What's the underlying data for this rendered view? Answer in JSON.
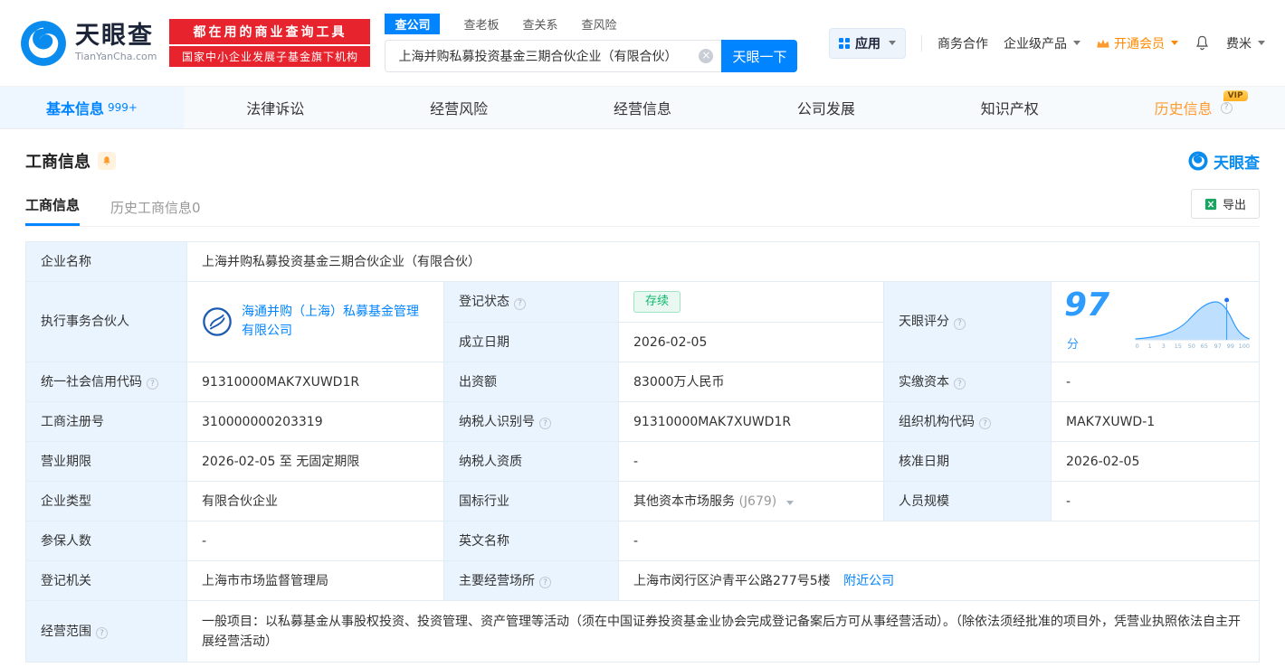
{
  "colors": {
    "blue": "#0084ff",
    "red": "#e7232d",
    "orange": "#ff9a2e",
    "green": "#0fb96c",
    "label_bg": "#e9f4fe"
  },
  "brand": {
    "name": "天眼查",
    "domain": "TianYanCha.com"
  },
  "banner": {
    "line1": "都在用的商业查询工具",
    "line2": "国家中小企业发展子基金旗下机构"
  },
  "search": {
    "tabs": [
      {
        "label": "查公司"
      },
      {
        "label": "查老板"
      },
      {
        "label": "查关系"
      },
      {
        "label": "查风险"
      }
    ],
    "value": "上海并购私募投资基金三期合伙企业（有限合伙）",
    "button": "天眼一下"
  },
  "header_right": {
    "apps": "应用",
    "cooperation": "商务合作",
    "enterprise": "企业级产品",
    "vip": "开通会员",
    "user": "费米"
  },
  "nav": {
    "tabs": [
      {
        "label": "基本信息",
        "badge": "999+"
      },
      {
        "label": "法律诉讼"
      },
      {
        "label": "经营风险"
      },
      {
        "label": "经营信息"
      },
      {
        "label": "公司发展"
      },
      {
        "label": "知识产权"
      },
      {
        "label": "历史信息",
        "vip": "VIP"
      }
    ]
  },
  "section": {
    "title": "工商信息",
    "logo_text": "天眼查",
    "tab_current": "工商信息",
    "tab_history": "历史工商信息0",
    "export": "导出"
  },
  "info": {
    "company_name_label": "企业名称",
    "company_name": "上海并购私募投资基金三期合伙企业（有限合伙）",
    "partner_label": "执行事务合伙人",
    "partner_name": "海通并购（上海）私募基金管理有限公司",
    "status_label": "登记状态",
    "status": "存续",
    "establish_label": "成立日期",
    "establish_date": "2026-02-05",
    "score_label": "天眼评分",
    "score": "97",
    "score_unit": "分",
    "credit_code_label": "统一社会信用代码",
    "credit_code": "91310000MAK7XUWD1R",
    "capital_label": "出资额",
    "capital": "83000万人民币",
    "paid_capital_label": "实缴资本",
    "paid_capital": "-",
    "reg_no_label": "工商注册号",
    "reg_no": "310000000203319",
    "taxpayer_id_label": "纳税人识别号",
    "taxpayer_id": "91310000MAK7XUWD1R",
    "org_code_label": "组织机构代码",
    "org_code": "MAK7XUWD-1",
    "term_label": "营业期限",
    "term": "2026-02-05 至 无固定期限",
    "taxpayer_quality_label": "纳税人资质",
    "taxpayer_quality": "-",
    "approve_label": "核准日期",
    "approve_date": "2026-02-05",
    "type_label": "企业类型",
    "type": "有限合伙企业",
    "industry_label": "国标行业",
    "industry": "其他资本市场服务",
    "industry_code": "(J679)",
    "staff_label": "人员规模",
    "staff": "-",
    "insured_label": "参保人数",
    "insured": "-",
    "en_name_label": "英文名称",
    "en_name": "-",
    "registry_label": "登记机关",
    "registry": "上海市市场监督管理局",
    "address_label": "主要经营场所",
    "address": "上海市闵行区沪青平公路277号5楼",
    "nearby": "附近公司",
    "scope_label": "经营范围",
    "scope": "一般项目：以私募基金从事股权投资、投资管理、资产管理等活动（须在中国证券投资基金业协会完成登记备案后方可从事经营活动）。（除依法须经批准的项目外，凭营业执照依法自主开展经营活动）"
  },
  "score_chart": {
    "type": "area",
    "score": 97,
    "ticks": [
      0,
      1,
      3,
      15,
      50,
      65,
      97,
      99,
      100
    ]
  }
}
